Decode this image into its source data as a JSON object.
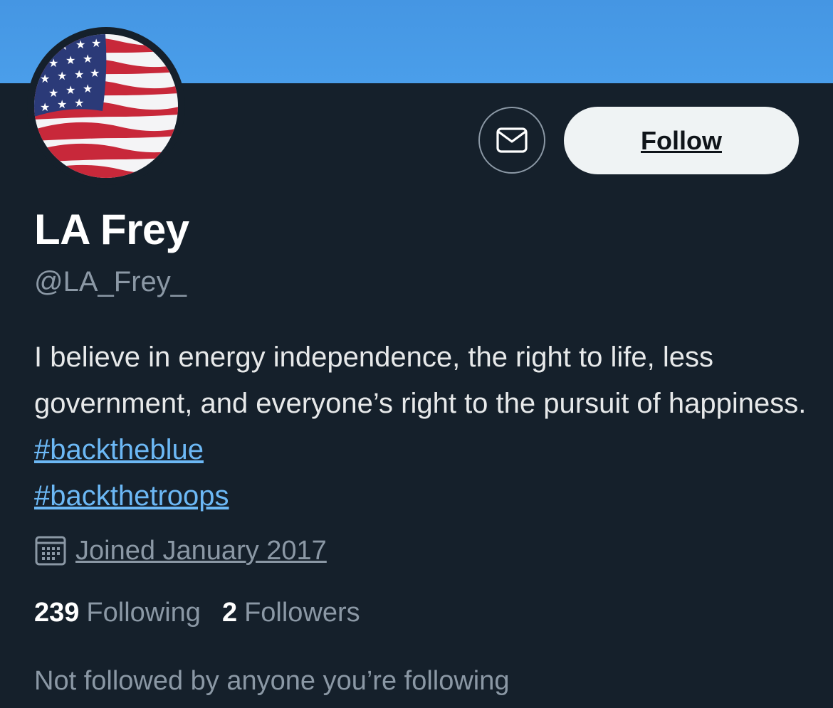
{
  "profile": {
    "display_name": "LA Frey",
    "handle": "@LA_Frey_",
    "avatar_icon": "us-flag-avatar",
    "bio": {
      "text": "I believe in energy independence, the right to life, less government, and everyone’s right to the pursuit of happiness.",
      "hashtag1": "#backtheblue",
      "hashtag2": "#backthetroops"
    },
    "joined": "Joined January 2017",
    "joined_icon": "calendar-icon"
  },
  "actions": {
    "message_icon": "envelope-icon",
    "follow_label": "Follow"
  },
  "stats": {
    "following_count": "239",
    "following_label": "Following",
    "followers_count": "2",
    "followers_label": "Followers"
  },
  "footer": {
    "mutuals_text": "Not followed by anyone you’re following"
  },
  "colors": {
    "background": "#15202b",
    "banner": "#4a9eea",
    "link": "#6cb8f5",
    "muted": "#8b98a5",
    "follow_bg": "#eff3f4"
  }
}
